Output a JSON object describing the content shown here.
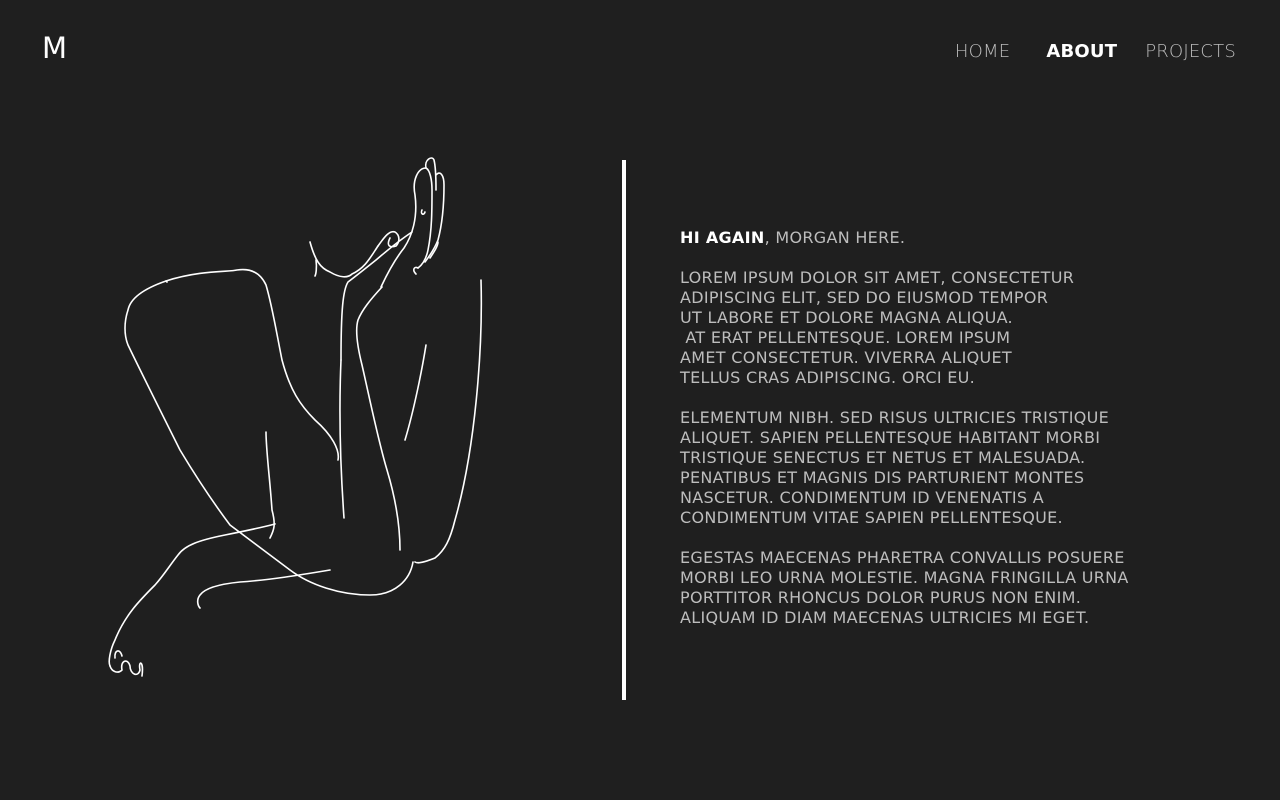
{
  "logo": "M",
  "nav": {
    "home": "HOME",
    "about": "ABOUT",
    "projects": "PROJECTS",
    "active": "about"
  },
  "intro": {
    "greeting": "HI AGAIN",
    "rest": ", MORGAN HERE."
  },
  "paragraphs": [
    [
      "LOREM IPSUM DOLOR SIT AMET, CONSECTETUR",
      "ADIPISCING ELIT, SED DO EIUSMOD TEMPOR",
      "UT LABORE ET DOLORE MAGNA ALIQUA.",
      " AT ERAT PELLENTESQUE. LOREM IPSUM",
      "AMET CONSECTETUR. VIVERRA ALIQUET",
      "TELLUS CRAS ADIPISCING. ORCI EU."
    ],
    [
      "ELEMENTUM NIBH. SED RISUS ULTRICIES TRISTIQUE",
      "ALIQUET. SAPIEN PELLENTESQUE HABITANT MORBI",
      "TRISTIQUE SENECTUS ET NETUS ET MALESUADA.",
      "PENATIBUS ET MAGNIS DIS PARTURIENT MONTES",
      "NASCETUR. CONDIMENTUM ID VENENATIS A",
      "CONDIMENTUM VITAE SAPIEN PELLENTESQUE."
    ],
    [
      "EGESTAS MAECENAS PHARETRA CONVALLIS POSUERE",
      "MORBI LEO URNA MOLESTIE. MAGNA FRINGILLA URNA",
      "PORTTITOR RHONCUS DOLOR PURUS NON ENIM.",
      "ALIQUAM ID DIAM MAECENAS ULTRICIES MI EGET."
    ]
  ],
  "colors": {
    "background": "#1f1f1f",
    "text": "#bdbdbd",
    "highlight": "#ffffff"
  },
  "illustration": {
    "icon": "line-art-figure-icon"
  }
}
